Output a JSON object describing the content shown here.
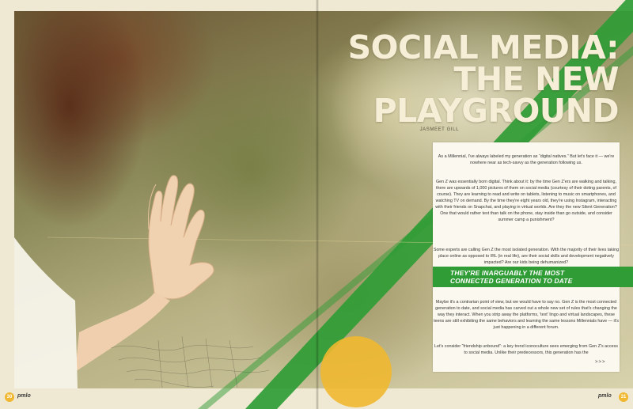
{
  "article": {
    "title_lines": [
      "SOCIAL MEDIA:",
      "THE NEW",
      "PLAYGROUND"
    ],
    "byline": "JASMEET GILL",
    "paragraphs": [
      "As a Millennial, I've always labeled my generation as “digital natives.” But let's face it — we're nowhere near as tech-savvy as the generation following us.",
      "Gen Z was essentially born digital. Think about it: by the time Gen Z'ers are walking and talking, there are upwards of 1,000 pictures of them on social media (courtesy of their doting parents, of course). They are learning to read and write on tablets, listening to music on smartphones, and watching TV on demand. By the time they're eight years old, they're using Instagram, interacting with their friends on Snapchat, and playing in virtual worlds. Are they the new Silent Generation? One that would rather text than talk on the phone, stay inside than go outside, and consider summer camp a punishment?",
      "Some experts are calling Gen Z the most isolated generation. With the majority of their lives taking place online as opposed to IRL (in real life), are their social skills and development negatively impacted? Are our kids being dehumanized?",
      "Maybe it's a contrarian point of view, but we would have to say no. Gen Z is the most connected generation to date, and social media has carved out a whole new set of rules that's changing the way they interact. When you strip away the platforms, 'text' lingo and virtual landscapes, these teens are still exhibiting the same behaviors and learning the same lessons Millennials have — it's just happening in a different forum.",
      "Let's consider “friendship unbound”: a key trend iconoculture sees emerging from Gen Z's access to social media. Unlike their predecessors, this generation has the"
    ],
    "pullquote_lines": [
      "THEY'RE INARGUABLY THE MOST",
      "CONNECTED GENERATION TO DATE"
    ],
    "continued": ">>>"
  },
  "footer": {
    "left_page": "30",
    "right_page": "31",
    "logo": "pmlo"
  },
  "colors": {
    "accent_green": "#2f9c35",
    "accent_yellow": "#f0b830",
    "title_cream": "#f6eed6"
  }
}
